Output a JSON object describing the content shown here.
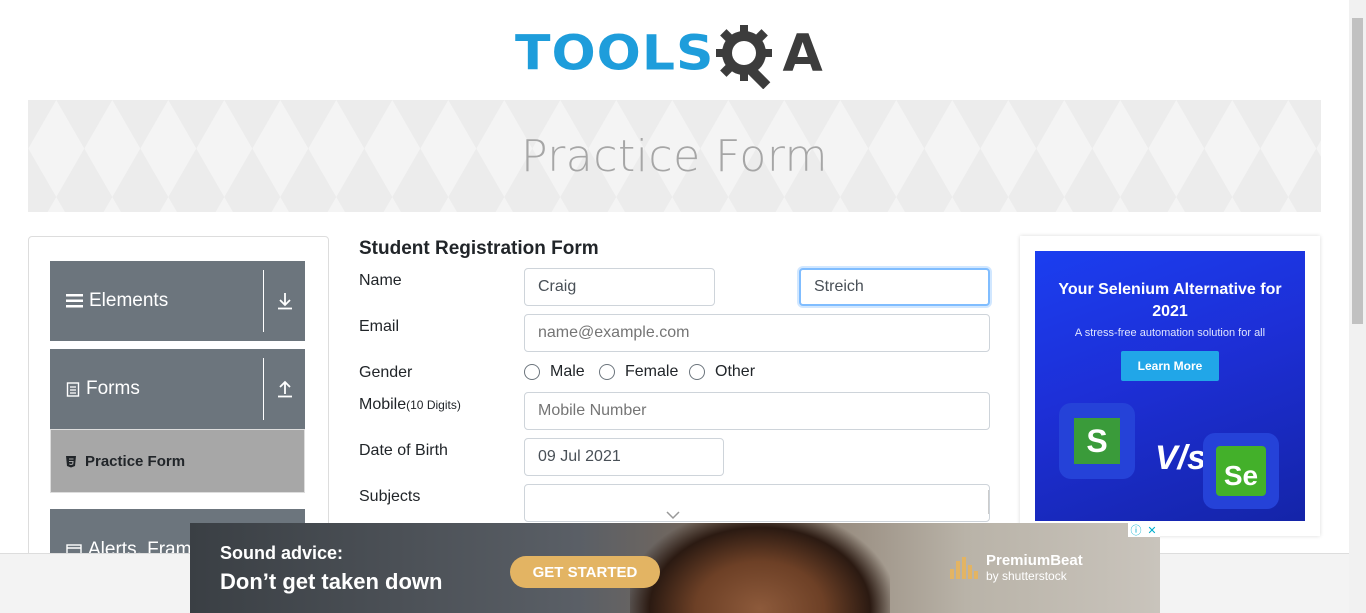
{
  "header": {
    "logo_tools": "TOOLS",
    "logo_qa": "A",
    "page_heading": "Practice Form"
  },
  "sidebar": {
    "groups": [
      {
        "label": "Elements",
        "toggle_icon": "arrow-down-icon"
      },
      {
        "label": "Forms",
        "toggle_icon": "arrow-up-icon"
      },
      {
        "label": "Alerts, Fram",
        "toggle_icon": ""
      }
    ],
    "active_item": "Practice Form"
  },
  "form": {
    "title": "Student Registration Form",
    "name_label": "Name",
    "first_name_value": "Craig",
    "last_name_value": "Streich",
    "email_label": "Email",
    "email_placeholder": "name@example.com",
    "gender_label": "Gender",
    "gender_options": [
      "Male",
      "Female",
      "Other"
    ],
    "mobile_label": "Mobile",
    "mobile_hint": "(10 Digits)",
    "mobile_placeholder": "Mobile Number",
    "dob_label": "Date of Birth",
    "dob_value": "09 Jul 2021",
    "subjects_label": "Subjects",
    "subjects_value": ""
  },
  "right_ad": {
    "headline": "Your Selenium Alternative for 2021",
    "subline": "A stress-free automation solution for all",
    "button": "Learn More",
    "logo_left": "S",
    "vs": "V/s",
    "logo_right": "Se"
  },
  "bottom_ad": {
    "line1": "Sound advice:",
    "line2": "Don’t get taken down",
    "cta": "GET STARTED",
    "brand_name": "PremiumBeat",
    "brand_by": "by shutterstock"
  },
  "colors": {
    "brand_blue": "#1e9ddb",
    "menu_gray": "#6c757d",
    "active_item_bg": "#a7a7a7",
    "focus_border": "#80bdff"
  }
}
